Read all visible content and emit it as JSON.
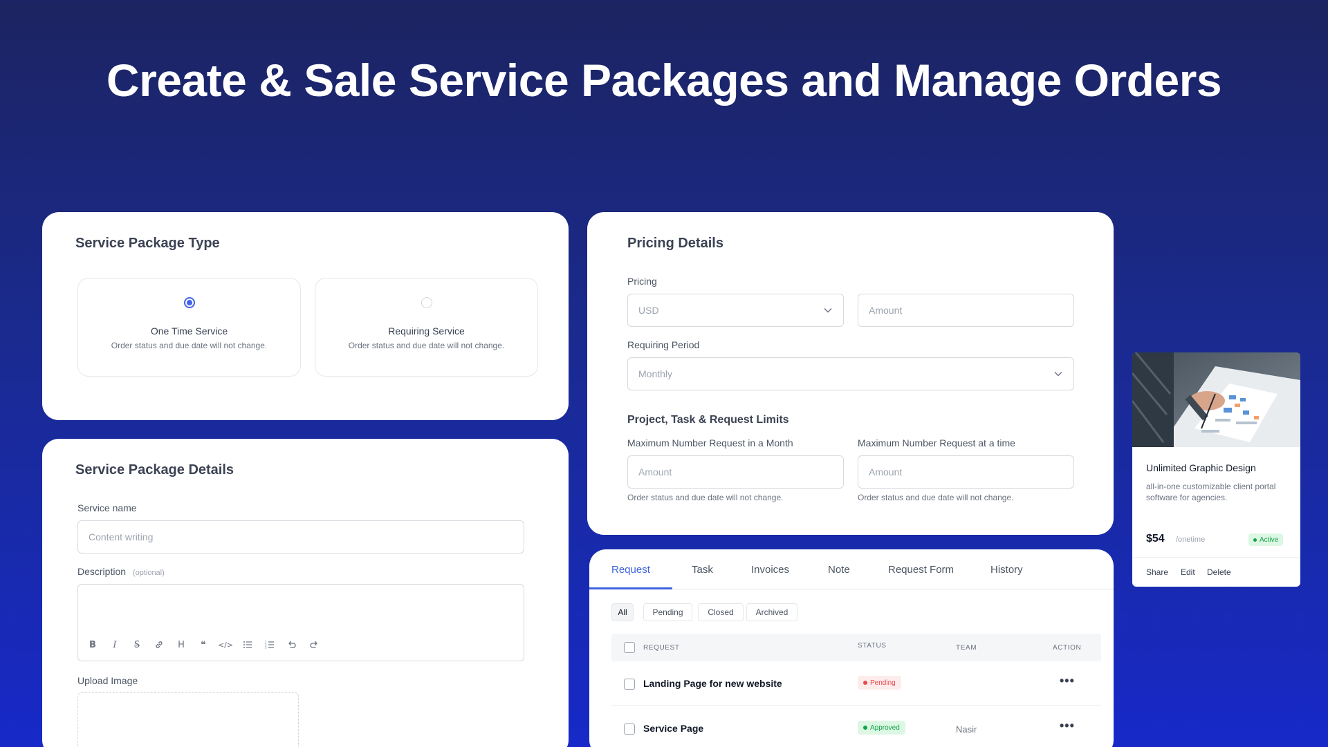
{
  "hero": {
    "title": "Create & Sale Service Packages and Manage Orders"
  },
  "type_card": {
    "title": "Service Package Type",
    "options": [
      {
        "title": "One Time Service",
        "desc": "Order status and due date will not change.",
        "selected": true
      },
      {
        "title": "Requiring Service",
        "desc": "Order status and due date will not change.",
        "selected": false
      }
    ]
  },
  "details_card": {
    "title": "Service Package Details",
    "service_name_label": "Service name",
    "service_name_placeholder": "Content writing",
    "description_label": "Description",
    "description_optional": "(optional)",
    "toolbar": [
      "bold-icon",
      "italic-icon",
      "strikethrough-icon",
      "link-icon",
      "heading-icon",
      "quote-icon",
      "code-icon",
      "bullet-list-icon",
      "numbered-list-icon",
      "undo-icon",
      "redo-icon"
    ],
    "upload_label": "Upload Image"
  },
  "pricing_card": {
    "title": "Pricing Details",
    "pricing_label": "Pricing",
    "currency_value": "USD",
    "amount_placeholder": "Amount",
    "period_label": "Requiring Period",
    "period_value": "Monthly",
    "limits_title": "Project, Task & Request Limits",
    "limit_month_label": "Maximum Number Request in a Month",
    "limit_time_label": "Maximum Number Request at a time",
    "limit_placeholder": "Amount",
    "limit_hint": "Order status and due date will not change."
  },
  "orders_card": {
    "tabs": [
      "Request",
      "Task",
      "Invoices",
      "Note",
      "Request Form",
      "History"
    ],
    "active_tab": "Request",
    "filters": [
      "All",
      "Pending",
      "Closed",
      "Archived"
    ],
    "columns": [
      "REQUEST",
      "STATUS",
      "TEAM",
      "ACTION"
    ],
    "rows": [
      {
        "request": "Landing Page for new website",
        "status": "Pending",
        "team": ""
      },
      {
        "request": "Service Page",
        "status": "Approved",
        "team": "Nasir"
      }
    ],
    "colors": {
      "pending_bg": "#fdecec",
      "pending_fg": "#e5484d",
      "approved_bg": "#dcf7e3",
      "approved_fg": "#16a34a",
      "accent": "#3e63dd"
    }
  },
  "product_card": {
    "title": "Unlimited Graphic Design",
    "desc": "all-in-one customizable client portal software for agencies.",
    "price": "$54",
    "period": "/onetime",
    "status": "Active",
    "actions": [
      "Share",
      "Edit",
      "Delete"
    ]
  }
}
